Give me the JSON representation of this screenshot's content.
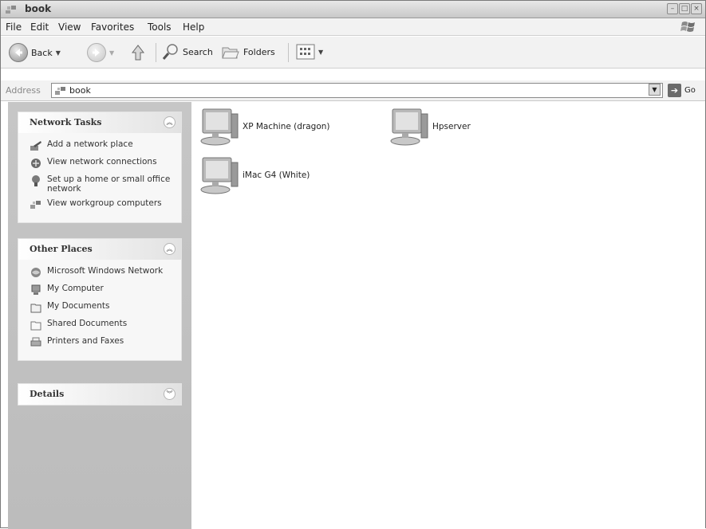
{
  "window": {
    "title": "book",
    "controls": [
      "minimize",
      "maximize",
      "close"
    ]
  },
  "menubar": {
    "items": [
      "File",
      "Edit",
      "View",
      "Favorites",
      "Tools",
      "Help"
    ]
  },
  "toolbar": {
    "back_label": "Back",
    "search_label": "Search",
    "folders_label": "Folders"
  },
  "address": {
    "label": "Address",
    "value": "book",
    "go_label": "Go"
  },
  "network_tasks": {
    "title": "Network Tasks",
    "items": [
      {
        "label": "Add a network place",
        "icon": "add-network-place-icon"
      },
      {
        "label": "View network connections",
        "icon": "network-connections-icon"
      },
      {
        "label": "Set up a home or small office network",
        "icon": "home-network-setup-icon"
      },
      {
        "label": "View workgroup computers",
        "icon": "workgroup-computers-icon"
      }
    ]
  },
  "other_places": {
    "title": "Other Places",
    "items": [
      {
        "label": "Microsoft Windows Network",
        "icon": "windows-network-icon"
      },
      {
        "label": "My Computer",
        "icon": "my-computer-icon"
      },
      {
        "label": "My Documents",
        "icon": "my-documents-icon"
      },
      {
        "label": "Shared Documents",
        "icon": "shared-documents-icon"
      },
      {
        "label": "Printers and Faxes",
        "icon": "printers-faxes-icon"
      }
    ]
  },
  "details": {
    "title": "Details"
  },
  "content": {
    "items": [
      {
        "label": "XP Machine (dragon)",
        "icon": "computer-icon"
      },
      {
        "label": "Hpserver",
        "icon": "computer-icon"
      },
      {
        "label": "iMac G4 (White)",
        "icon": "computer-icon"
      }
    ]
  }
}
